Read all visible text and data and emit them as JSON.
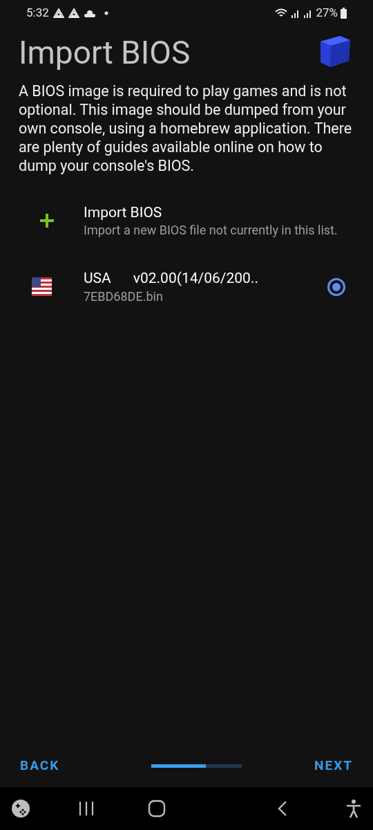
{
  "status_bar": {
    "time": "5:32",
    "battery": "27%"
  },
  "title": "Import BIOS",
  "description": "A BIOS image is required to play games and is not optional. This image should be dumped from your own console, using a homebrew application. There are plenty of guides available online on how to dump your console's BIOS.",
  "items": [
    {
      "kind": "import",
      "title": "Import BIOS",
      "subtitle": "Import a new BIOS file not currently in this list."
    },
    {
      "kind": "bios",
      "region": "USA",
      "version": "v02.00(14/06/200..",
      "file": "7EBD68DE.bin",
      "selected": true
    }
  ],
  "footer": {
    "back": "BACK",
    "next": "NEXT",
    "progress": {
      "level": 0.6
    }
  }
}
